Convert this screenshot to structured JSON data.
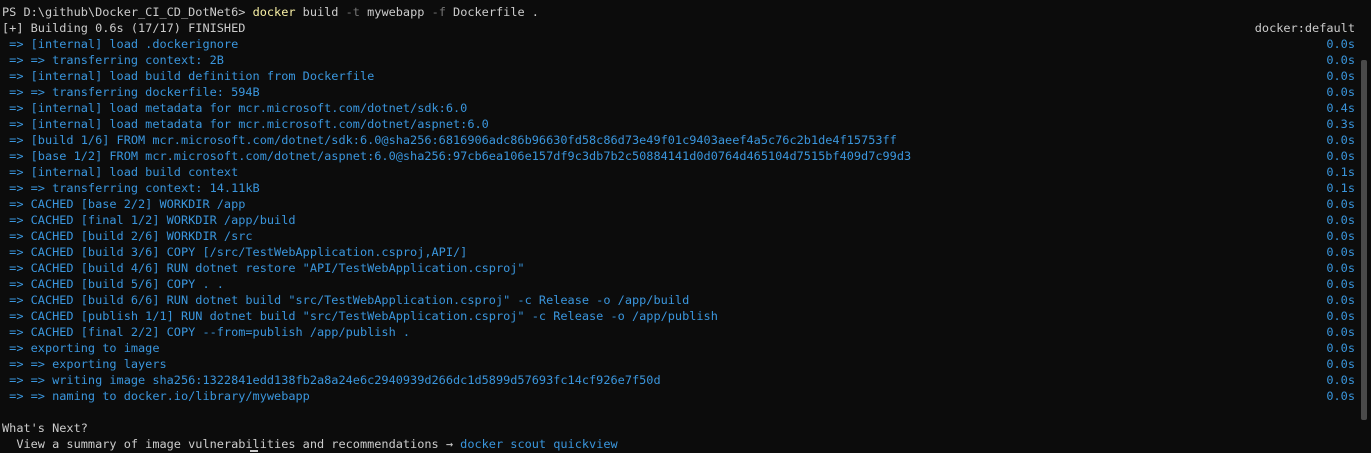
{
  "prompt": {
    "path": "PS D:\\github\\Docker_CI_CD_DotNet6> ",
    "command": "docker",
    "args": [
      {
        "text": " build ",
        "style": "white"
      },
      {
        "text": "-t",
        "style": "gray"
      },
      {
        "text": " mywebapp ",
        "style": "white"
      },
      {
        "text": "-f",
        "style": "gray"
      },
      {
        "text": " Dockerfile .",
        "style": "white"
      }
    ]
  },
  "build_header": {
    "status": "[+] Building 0.6s (17/17) FINISHED",
    "driver": "docker:default"
  },
  "steps": [
    {
      "text": " => [internal] load .dockerignore",
      "time": "0.0s"
    },
    {
      "text": " => => transferring context: 2B",
      "time": "0.0s"
    },
    {
      "text": " => [internal] load build definition from Dockerfile",
      "time": "0.0s"
    },
    {
      "text": " => => transferring dockerfile: 594B",
      "time": "0.0s"
    },
    {
      "text": " => [internal] load metadata for mcr.microsoft.com/dotnet/sdk:6.0",
      "time": "0.4s"
    },
    {
      "text": " => [internal] load metadata for mcr.microsoft.com/dotnet/aspnet:6.0",
      "time": "0.3s"
    },
    {
      "text": " => [build 1/6] FROM mcr.microsoft.com/dotnet/sdk:6.0@sha256:6816906adc86b96630fd58c86d73e49f01c9403aeef4a5c76c2b1de4f15753ff",
      "time": "0.0s"
    },
    {
      "text": " => [base 1/2] FROM mcr.microsoft.com/dotnet/aspnet:6.0@sha256:97cb6ea106e157df9c3db7b2c50884141d0d0764d465104d7515bf409d7c99d3",
      "time": "0.0s"
    },
    {
      "text": " => [internal] load build context",
      "time": "0.1s"
    },
    {
      "text": " => => transferring context: 14.11kB",
      "time": "0.1s"
    },
    {
      "text": " => CACHED [base 2/2] WORKDIR /app",
      "time": "0.0s"
    },
    {
      "text": " => CACHED [final 1/2] WORKDIR /app/build",
      "time": "0.0s"
    },
    {
      "text": " => CACHED [build 2/6] WORKDIR /src",
      "time": "0.0s"
    },
    {
      "text": " => CACHED [build 3/6] COPY [/src/TestWebApplication.csproj,API/]",
      "time": "0.0s"
    },
    {
      "text": " => CACHED [build 4/6] RUN dotnet restore \"API/TestWebApplication.csproj\"",
      "time": "0.0s"
    },
    {
      "text": " => CACHED [build 5/6] COPY . .",
      "time": "0.0s"
    },
    {
      "text": " => CACHED [build 6/6] RUN dotnet build \"src/TestWebApplication.csproj\" -c Release -o /app/build",
      "time": "0.0s"
    },
    {
      "text": " => CACHED [publish 1/1] RUN dotnet build \"src/TestWebApplication.csproj\" -c Release -o /app/publish",
      "time": "0.0s"
    },
    {
      "text": " => CACHED [final 2/2] COPY --from=publish /app/publish .",
      "time": "0.0s"
    },
    {
      "text": " => exporting to image",
      "time": "0.0s"
    },
    {
      "text": " => => exporting layers",
      "time": "0.0s"
    },
    {
      "text": " => => writing image sha256:1322841edd138fb2a8a24e6c2940939d266dc1d5899d57693fc14cf926e7f50d",
      "time": "0.0s"
    },
    {
      "text": " => => naming to docker.io/library/mywebapp",
      "time": "0.0s"
    }
  ],
  "whats_next": {
    "heading": "What's Next?",
    "summary_text": "  View a summary of image vulnerabilities and recommendations → ",
    "summary_command": "docker scout quickview"
  },
  "colors": {
    "background": "#0c0c0c",
    "text": "#cccccc",
    "step": "#3a96dd",
    "command": "#f9f1a5",
    "flag": "#767676"
  }
}
